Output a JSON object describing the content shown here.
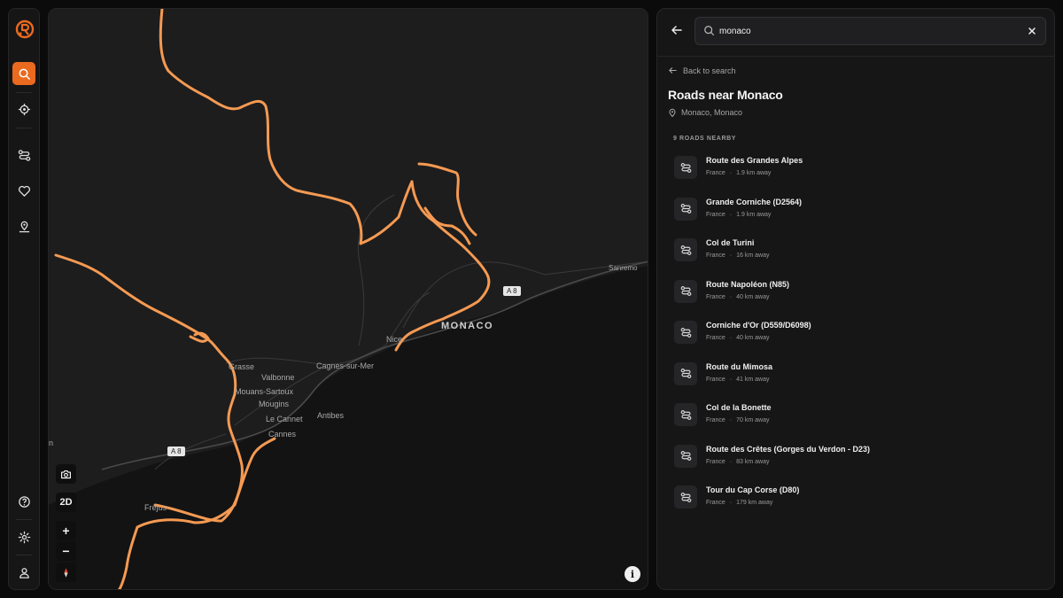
{
  "app": {
    "logo": "app-logo",
    "accent": "#ea6a1f"
  },
  "rail": {
    "items": [
      {
        "icon": "search-icon",
        "active": true
      },
      {
        "icon": "locate-icon",
        "active": false
      },
      {
        "icon": "route-icon",
        "active": false
      },
      {
        "icon": "heart-icon",
        "active": false
      },
      {
        "icon": "map-pin-user-icon",
        "active": false
      }
    ],
    "bottom": [
      {
        "icon": "help-icon"
      },
      {
        "icon": "settings-icon"
      },
      {
        "icon": "user-icon"
      }
    ]
  },
  "map": {
    "labels": {
      "monaco": "MONACO",
      "nice": "Nice",
      "sanremo": "Sanremo",
      "grasse": "Grasse",
      "cagnes": "Cagnes-sur-Mer",
      "valbonne": "Valbonne",
      "mouans": "Mouans-Sartoux",
      "mougins": "Mougins",
      "lecannet": "Le Cannet",
      "antibes": "Antibes",
      "cannes": "Cannes",
      "frejus": "Fréjus",
      "edge_n": "n"
    },
    "shields": {
      "a8_east": "A 8",
      "a8_west": "A 8"
    },
    "controls": {
      "mode_label": "2D",
      "zoom_in": "+",
      "zoom_out": "−",
      "info": "i"
    },
    "route_color": "#f59a52"
  },
  "panel": {
    "search": {
      "value": "monaco",
      "placeholder": "Search"
    },
    "back_link": "Back to search",
    "title": "Roads near Monaco",
    "location": "Monaco, Monaco",
    "count_label": "9 ROADS NEARBY",
    "roads": [
      {
        "name": "Route des Grandes Alpes",
        "country": "France",
        "distance": "1.9 km away"
      },
      {
        "name": "Grande Corniche (D2564)",
        "country": "France",
        "distance": "1.9 km away"
      },
      {
        "name": "Col de Turini",
        "country": "France",
        "distance": "16 km away"
      },
      {
        "name": "Route Napoléon (N85)",
        "country": "France",
        "distance": "40 km away"
      },
      {
        "name": "Corniche d'Or (D559/D6098)",
        "country": "France",
        "distance": "40 km away"
      },
      {
        "name": "Route du Mimosa",
        "country": "France",
        "distance": "41 km away"
      },
      {
        "name": "Col de la Bonette",
        "country": "France",
        "distance": "70 km away"
      },
      {
        "name": "Route des Crêtes (Gorges du Verdon - D23)",
        "country": "France",
        "distance": "83 km away"
      },
      {
        "name": "Tour du Cap Corse (D80)",
        "country": "France",
        "distance": "179 km away"
      }
    ]
  }
}
